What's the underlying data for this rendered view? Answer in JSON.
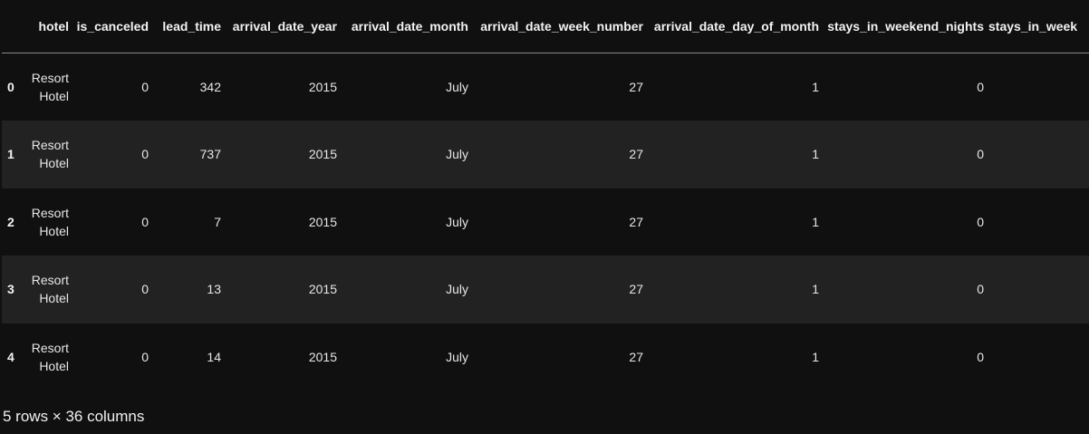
{
  "columns": [
    "",
    "hotel",
    "is_canceled",
    "lead_time",
    "arrival_date_year",
    "arrival_date_month",
    "arrival_date_week_number",
    "arrival_date_day_of_month",
    "stays_in_weekend_nights",
    "stays_in_week"
  ],
  "rows": [
    {
      "index": "0",
      "hotel": "Resort Hotel",
      "is_canceled": "0",
      "lead_time": "342",
      "arrival_date_year": "2015",
      "arrival_date_month": "July",
      "arrival_date_week_number": "27",
      "arrival_date_day_of_month": "1",
      "stays_in_weekend_nights": "0"
    },
    {
      "index": "1",
      "hotel": "Resort Hotel",
      "is_canceled": "0",
      "lead_time": "737",
      "arrival_date_year": "2015",
      "arrival_date_month": "July",
      "arrival_date_week_number": "27",
      "arrival_date_day_of_month": "1",
      "stays_in_weekend_nights": "0"
    },
    {
      "index": "2",
      "hotel": "Resort Hotel",
      "is_canceled": "0",
      "lead_time": "7",
      "arrival_date_year": "2015",
      "arrival_date_month": "July",
      "arrival_date_week_number": "27",
      "arrival_date_day_of_month": "1",
      "stays_in_weekend_nights": "0"
    },
    {
      "index": "3",
      "hotel": "Resort Hotel",
      "is_canceled": "0",
      "lead_time": "13",
      "arrival_date_year": "2015",
      "arrival_date_month": "July",
      "arrival_date_week_number": "27",
      "arrival_date_day_of_month": "1",
      "stays_in_weekend_nights": "0"
    },
    {
      "index": "4",
      "hotel": "Resort Hotel",
      "is_canceled": "0",
      "lead_time": "14",
      "arrival_date_year": "2015",
      "arrival_date_month": "July",
      "arrival_date_week_number": "27",
      "arrival_date_day_of_month": "1",
      "stays_in_weekend_nights": "0"
    }
  ],
  "footer": "5 rows × 36 columns"
}
